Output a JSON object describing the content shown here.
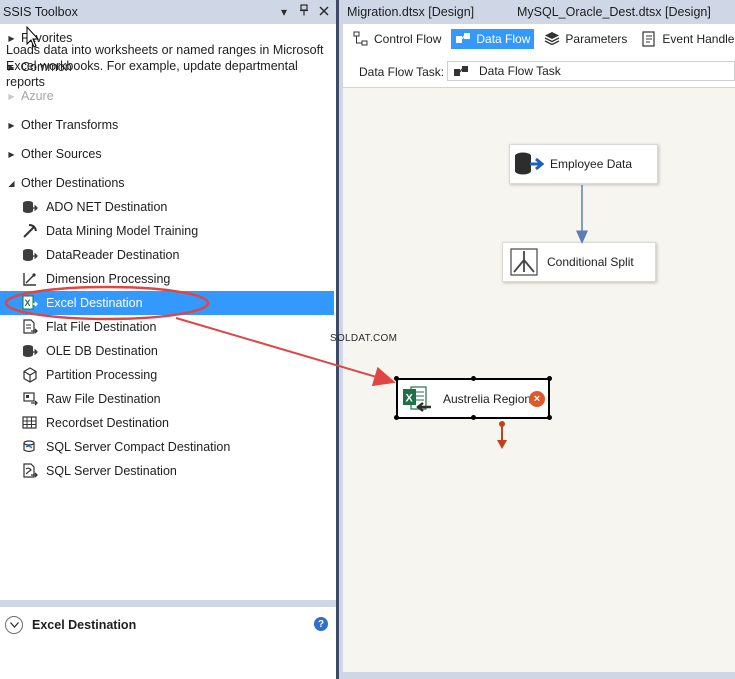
{
  "toolbox": {
    "title": "SSIS Toolbox",
    "header_icons": [
      "dropdown-icon",
      "pin-icon",
      "close-icon"
    ],
    "groups": [
      {
        "label": "Favorites",
        "expanded": false,
        "enabled": true
      },
      {
        "label": "Common",
        "expanded": false,
        "enabled": true
      },
      {
        "label": "Azure",
        "expanded": false,
        "enabled": false
      },
      {
        "label": "Other Transforms",
        "expanded": false,
        "enabled": true
      },
      {
        "label": "Other Sources",
        "expanded": false,
        "enabled": true
      },
      {
        "label": "Other Destinations",
        "expanded": true,
        "enabled": true
      }
    ],
    "items": [
      {
        "label": "ADO NET Destination",
        "icon": "ado-net-destination-icon"
      },
      {
        "label": "Data Mining Model Training",
        "icon": "data-mining-icon"
      },
      {
        "label": "DataReader Destination",
        "icon": "datareader-destination-icon"
      },
      {
        "label": "Dimension Processing",
        "icon": "dimension-processing-icon"
      },
      {
        "label": "Excel Destination",
        "icon": "excel-destination-icon",
        "selected": true
      },
      {
        "label": "Flat File Destination",
        "icon": "flat-file-destination-icon"
      },
      {
        "label": "OLE DB Destination",
        "icon": "ole-db-destination-icon"
      },
      {
        "label": "Partition Processing",
        "icon": "partition-processing-icon"
      },
      {
        "label": "Raw File Destination",
        "icon": "raw-file-destination-icon"
      },
      {
        "label": "Recordset Destination",
        "icon": "recordset-destination-icon"
      },
      {
        "label": "SQL Server Compact Destination",
        "icon": "sql-compact-destination-icon"
      },
      {
        "label": "SQL Server Destination",
        "icon": "sql-server-destination-icon"
      }
    ],
    "description": {
      "title": "Excel Destination",
      "text": "Loads data into worksheets or named ranges in Microsoft Excel workbooks. For example, update departmental reports"
    }
  },
  "designer": {
    "doc_tabs": [
      "Migration.dtsx [Design]",
      "MySQL_Oracle_Dest.dtsx [Design]"
    ],
    "tabs": [
      {
        "label": "Control Flow",
        "icon": "control-flow-icon",
        "active": false
      },
      {
        "label": "Data Flow",
        "icon": "data-flow-icon",
        "active": true
      },
      {
        "label": "Parameters",
        "icon": "parameters-icon",
        "active": false
      },
      {
        "label": "Event Handlers",
        "icon": "event-handlers-icon",
        "active": false
      }
    ],
    "task_label": "Data Flow Task:",
    "task_value": "Data Flow Task",
    "nodes": {
      "employee": {
        "label": "Employee Data",
        "icon": "database-source-icon"
      },
      "split": {
        "label": "Conditional Split",
        "icon": "conditional-split-icon"
      },
      "australia": {
        "label": "Austrelia Region",
        "icon": "excel-destination-icon",
        "error_badge": "×"
      }
    },
    "watermark": "SOLDAT.COM"
  },
  "colors": {
    "selection": "#3399ff",
    "chrome": "#cfd6e5",
    "canvas": "#f7f5ef",
    "annotation_red": "#e04545",
    "path_blue": "#5b7fb3",
    "error_path": "#c0411c",
    "excel_green": "#1e7145"
  }
}
